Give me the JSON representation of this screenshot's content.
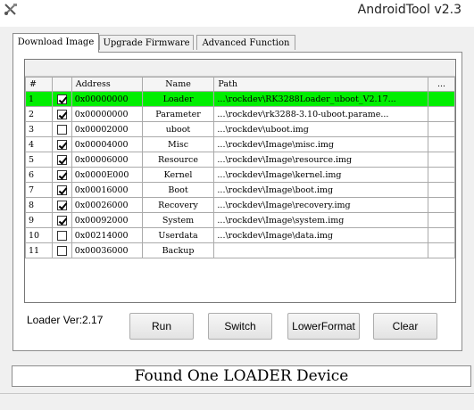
{
  "window": {
    "title": "AndroidTool v2.3"
  },
  "tabs": [
    {
      "label": "Download Image",
      "active": true
    },
    {
      "label": "Upgrade Firmware",
      "active": false
    },
    {
      "label": "Advanced Function",
      "active": false
    }
  ],
  "table": {
    "headers": {
      "index": "#",
      "check": "",
      "address": "Address",
      "name": "Name",
      "path": "Path",
      "more": "..."
    },
    "rows": [
      {
        "index": "1",
        "checked": true,
        "address": "0x00000000",
        "name": "Loader",
        "path": "...\\rockdev\\RK3288Loader_uboot_V2.17...",
        "selected": true
      },
      {
        "index": "2",
        "checked": true,
        "address": "0x00000000",
        "name": "Parameter",
        "path": "...\\rockdev\\rk3288-3.10-uboot.parame...",
        "selected": false
      },
      {
        "index": "3",
        "checked": false,
        "address": "0x00002000",
        "name": "uboot",
        "path": "...\\rockdev\\uboot.img",
        "selected": false
      },
      {
        "index": "4",
        "checked": true,
        "address": "0x00004000",
        "name": "Misc",
        "path": "...\\rockdev\\Image\\misc.img",
        "selected": false
      },
      {
        "index": "5",
        "checked": true,
        "address": "0x00006000",
        "name": "Resource",
        "path": "...\\rockdev\\Image\\resource.img",
        "selected": false
      },
      {
        "index": "6",
        "checked": true,
        "address": "0x0000E000",
        "name": "Kernel",
        "path": "...\\rockdev\\Image\\kernel.img",
        "selected": false
      },
      {
        "index": "7",
        "checked": true,
        "address": "0x00016000",
        "name": "Boot",
        "path": "...\\rockdev\\Image\\boot.img",
        "selected": false
      },
      {
        "index": "8",
        "checked": true,
        "address": "0x00026000",
        "name": "Recovery",
        "path": "...\\rockdev\\Image\\recovery.img",
        "selected": false
      },
      {
        "index": "9",
        "checked": true,
        "address": "0x00092000",
        "name": "System",
        "path": "...\\rockdev\\Image\\system.img",
        "selected": false
      },
      {
        "index": "10",
        "checked": false,
        "address": "0x00214000",
        "name": "Userdata",
        "path": "...\\rockdev\\Image\\data.img",
        "selected": false
      },
      {
        "index": "11",
        "checked": false,
        "address": "0x00036000",
        "name": "Backup",
        "path": "",
        "selected": false
      }
    ]
  },
  "loader_version": "Loader Ver:2.17",
  "buttons": {
    "run": "Run",
    "switch": "Switch",
    "lower_format": "LowerFormat",
    "clear": "Clear"
  },
  "status": {
    "message": "Found One LOADER Device"
  },
  "colors": {
    "selected_row": "#00ee00"
  },
  "icons": {
    "app": "tools-icon"
  }
}
